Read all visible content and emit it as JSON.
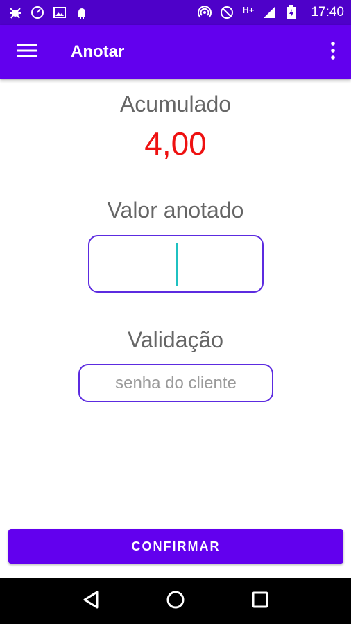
{
  "status_bar": {
    "time": "17:40",
    "network": "H+",
    "icons_left": [
      "bug-icon",
      "speed-icon",
      "image-icon",
      "android-icon"
    ],
    "icons_right": [
      "hotspot-icon",
      "block-icon",
      "signal-icon",
      "battery-icon"
    ]
  },
  "app_bar": {
    "title": "Anotar",
    "menu_icon": "hamburger-menu-icon",
    "overflow_icon": "more-vertical-icon",
    "color": "#6200ee"
  },
  "accumulated": {
    "label": "Acumulado",
    "value": "4,00",
    "value_color": "#ee1111"
  },
  "amount_field": {
    "label": "Valor anotado",
    "value": ""
  },
  "validation_field": {
    "label": "Validação",
    "placeholder": "senha do cliente"
  },
  "confirm_button": {
    "label": "CONFIRMAR"
  },
  "nav_bar": {
    "back": "back-icon",
    "home": "home-icon",
    "recents": "recents-icon"
  }
}
